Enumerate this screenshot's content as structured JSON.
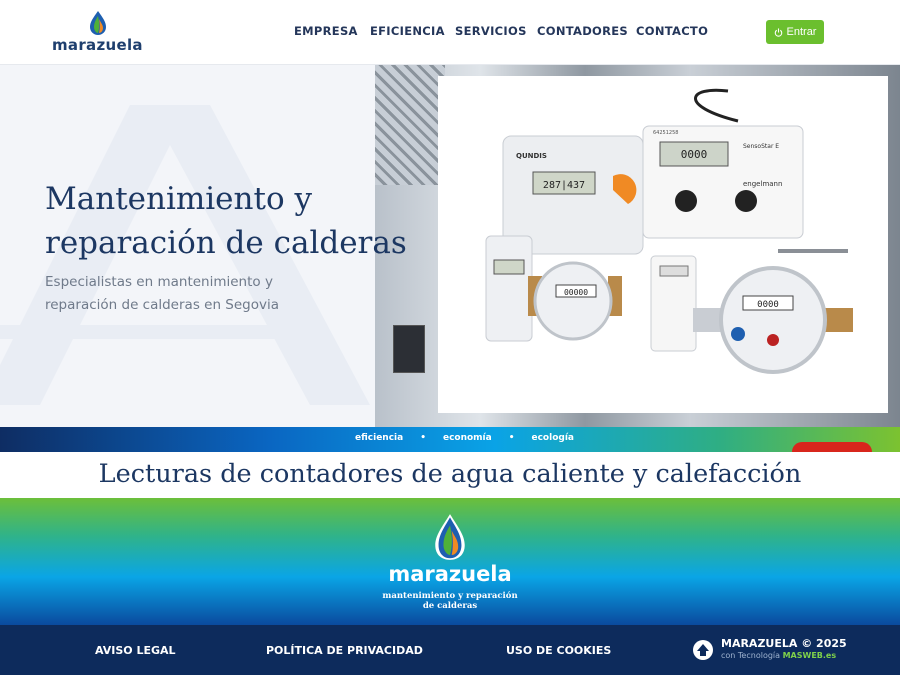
{
  "header": {
    "logo_text": "marazuela",
    "nav": [
      "EMPRESA",
      "EFICIENCIA",
      "SERVICIOS",
      "CONTADORES",
      "CONTACTO"
    ],
    "login_label": "Entrar"
  },
  "hero": {
    "title_line1": "Mantenimiento y",
    "title_line2": "reparación de calderas",
    "subtitle_line1": "Especialistas en mantenimiento y",
    "subtitle_line2": "reparación de calderas en Segovia",
    "product_labels": {
      "brand1": "QUNDIS",
      "brand2": "engelmann",
      "meter_model": "SensoStar E",
      "serial": "64251258",
      "display1": "287|437",
      "display2": "0000",
      "display3": "00000",
      "display4": "0000"
    }
  },
  "strip": {
    "items": [
      "eficiencia",
      "economía",
      "ecología"
    ],
    "separator": "•"
  },
  "section": {
    "title": "Lecturas de contadores de agua caliente y calefacción"
  },
  "footer": {
    "logo_text": "marazuela",
    "tagline_line1": "mantenimiento y reparación",
    "tagline_line2": "de calderas",
    "links": [
      "AVISO LEGAL",
      "POLÍTICA DE PRIVACIDAD",
      "USO DE COOKIES"
    ],
    "copyright": "MARAZUELA © 2025",
    "tech_prefix": "con Tecnología",
    "tech_name": "MASWEB.es"
  },
  "colors": {
    "navy": "#1c3762",
    "green": "#6bbf2e",
    "blue": "#0aa5e6"
  }
}
